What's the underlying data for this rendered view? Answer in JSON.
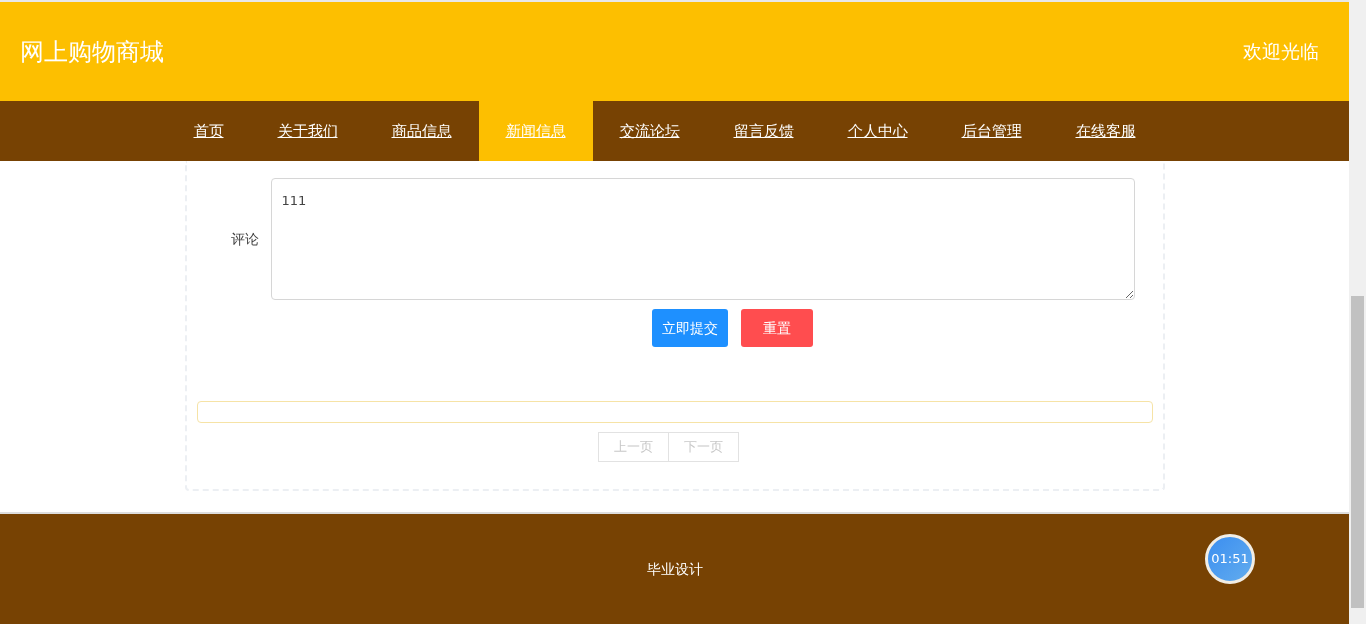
{
  "header": {
    "title": "网上购物商城",
    "welcome": "欢迎光临"
  },
  "nav": [
    {
      "label": "首页",
      "selected": false
    },
    {
      "label": "关于我们",
      "selected": false
    },
    {
      "label": "商品信息",
      "selected": false
    },
    {
      "label": "新闻信息",
      "selected": true
    },
    {
      "label": "交流论坛",
      "selected": false
    },
    {
      "label": "留言反馈",
      "selected": false
    },
    {
      "label": "个人中心",
      "selected": false
    },
    {
      "label": "后台管理",
      "selected": false
    },
    {
      "label": "在线客服",
      "selected": false
    }
  ],
  "comment_form": {
    "label": "评论",
    "value": "111",
    "buttons": [
      {
        "label": "立即提交",
        "kind": "primary"
      },
      {
        "label": "重置",
        "kind": "danger"
      }
    ]
  },
  "pagination": [
    {
      "label": "上一页",
      "disabled": true
    },
    {
      "label": "下一页",
      "disabled": true
    }
  ],
  "footer": {
    "text": "毕业设计"
  },
  "timer": {
    "text": "01:51"
  }
}
